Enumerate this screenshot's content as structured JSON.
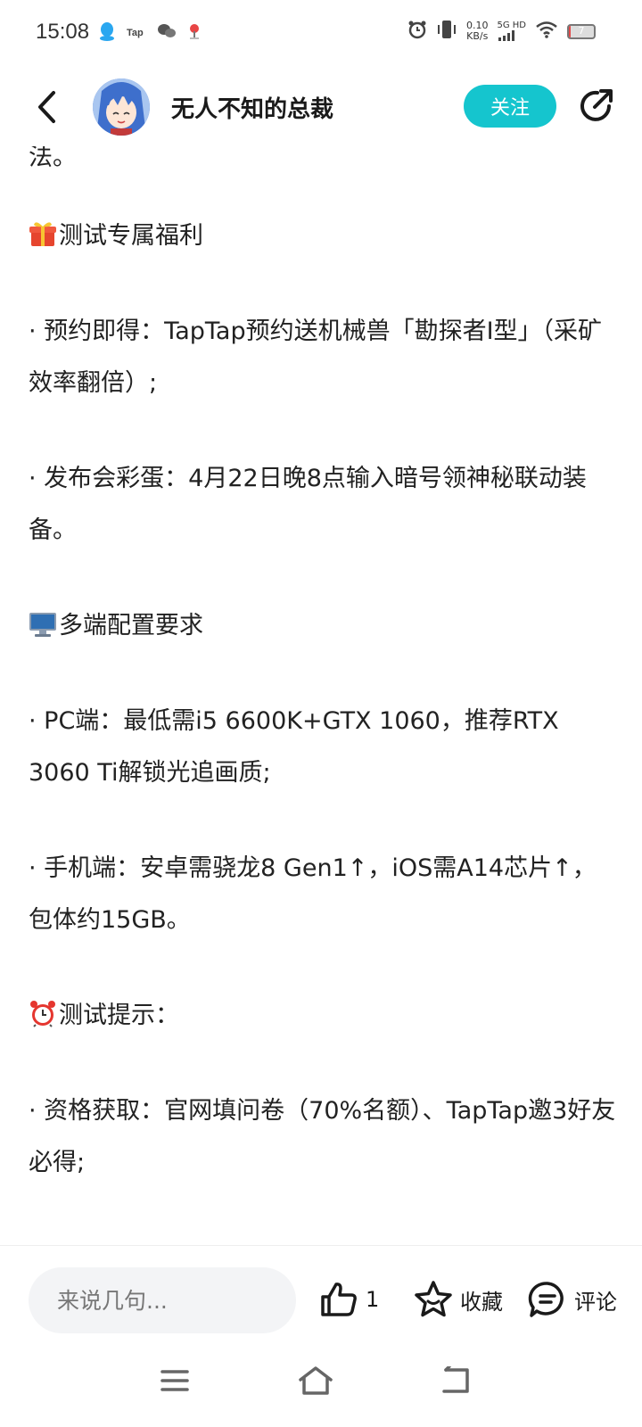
{
  "status_bar": {
    "time": "15:08",
    "net_speed_value": "0.10",
    "net_speed_unit": "KB/s",
    "signal_label": "5G HD",
    "battery_level": "7",
    "left_icons": [
      "qq-icon",
      "taptap-icon",
      "wechat-icon",
      "location-pin-icon"
    ],
    "right_icons": [
      "alarm-icon",
      "vibrate-icon",
      "wifi-icon",
      "battery-icon"
    ]
  },
  "header": {
    "author_name": "无人不知的总裁",
    "follow_label": "关注"
  },
  "content": {
    "clipped_text": "法。",
    "paragraphs": [
      {
        "emoji": "gift",
        "text": "测试专属福利"
      },
      {
        "text": "· 预约即得：TapTap预约送机械兽「勘探者I型」（采矿效率翻倍）;"
      },
      {
        "text": "· 发布会彩蛋：4月22日晚8点输入暗号领神秘联动装备。"
      },
      {
        "emoji": "computer",
        "text": "多端配置要求"
      },
      {
        "text": "· PC端：最低需i5 6600K+GTX 1060，推荐RTX 3060 Ti解锁光追画质;"
      },
      {
        "text": "· 手机端：安卓需骁龙8 Gen1↑，iOS需A14芯片↑，包体约15GB。"
      },
      {
        "emoji": "alarm-clock",
        "text": "测试提示："
      },
      {
        "text": "· 资格获取：官网填问卷（70%名额）、TapTap邀3好友必得;"
      }
    ]
  },
  "bottom_bar": {
    "comment_placeholder": "来说几句...",
    "like_count": "1",
    "favorite_label": "收藏",
    "comment_label": "评论"
  },
  "colors": {
    "accent": "#15c5ce",
    "text": "#222222",
    "input_bg": "#f3f4f6"
  }
}
